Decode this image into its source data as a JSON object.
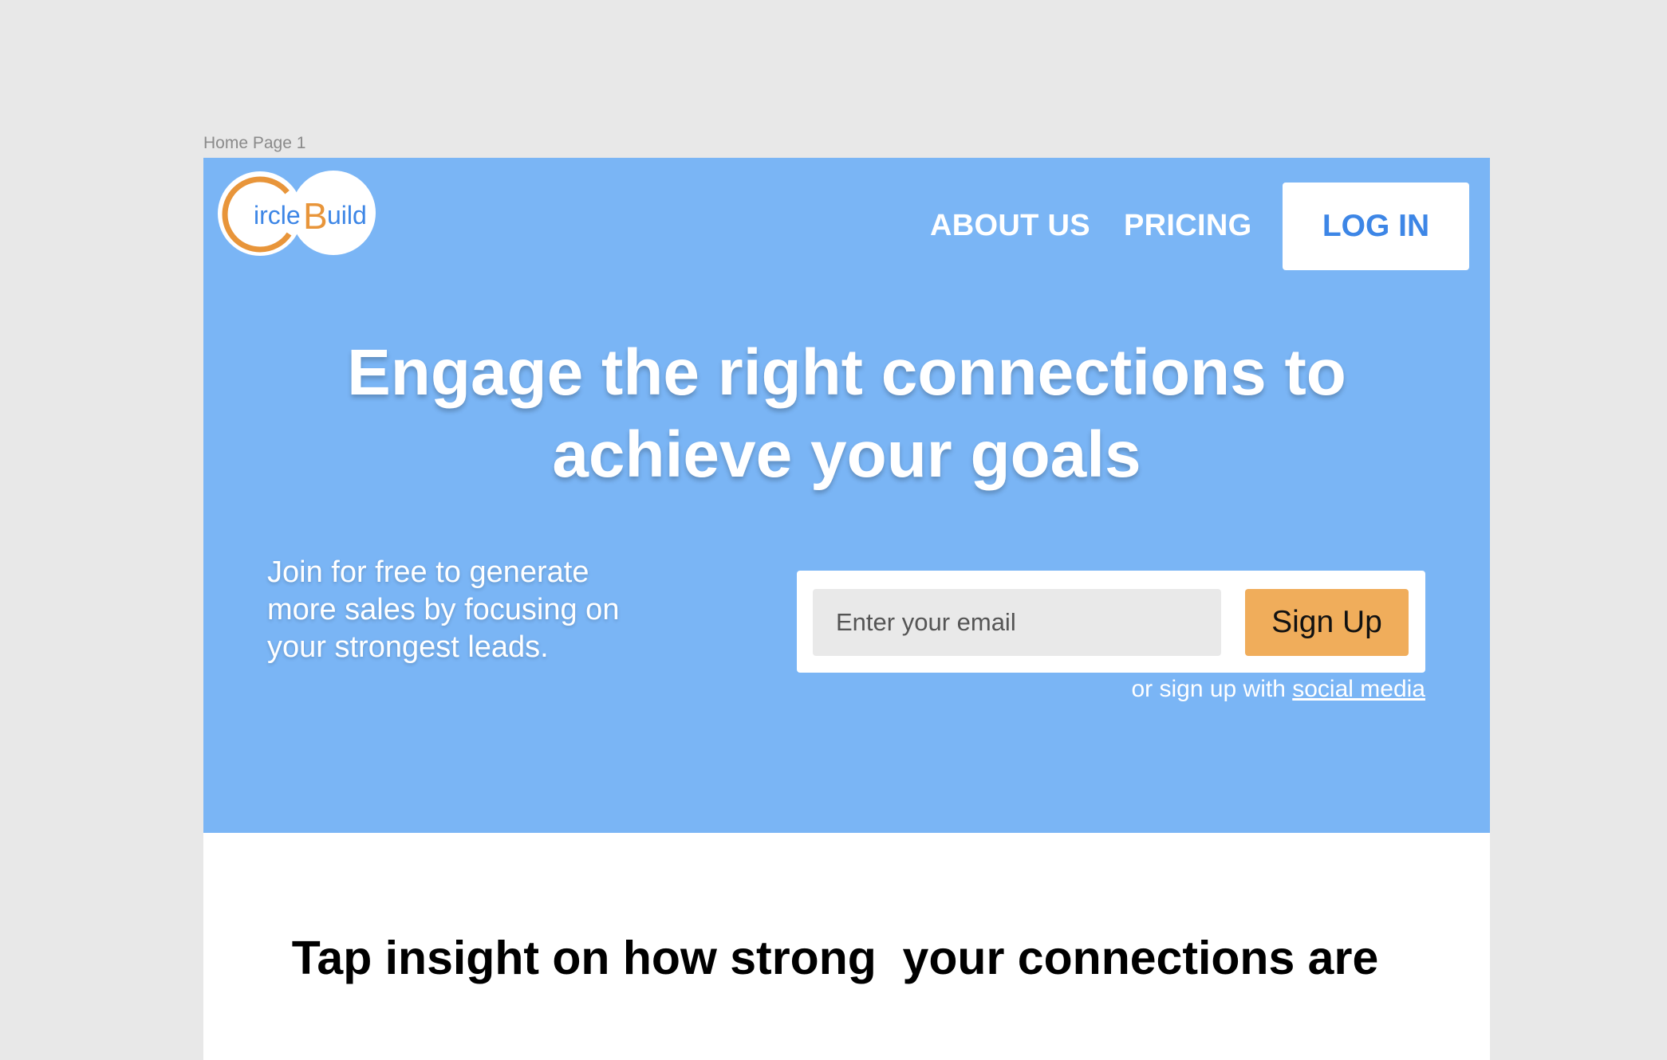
{
  "canvas": {
    "frame_label": "Home Page 1"
  },
  "logo": {
    "letter_c": "C",
    "text_ircle": "ircle",
    "letter_b": "B",
    "text_uild": "uild",
    "colors": {
      "orange": "#e8953a",
      "blue": "#3d86e6"
    }
  },
  "nav": {
    "about": "ABOUT US",
    "pricing": "PRICING",
    "login": "LOG IN"
  },
  "hero": {
    "headline_line1": "Engage the right connections to",
    "headline_line2": "achieve your goals",
    "sub_line1": "Join for free to generate",
    "sub_line2": "more sales by focusing on",
    "sub_line3": "your strongest leads.",
    "background_color": "#7ab5f5"
  },
  "signup": {
    "email_placeholder": "Enter your email",
    "email_value": "",
    "button_label": "Sign Up",
    "button_color": "#f0ad5b",
    "alt_prefix": "or sign up with ",
    "alt_link": "social media"
  },
  "section": {
    "title": "Tap insight on how strong  your connections are"
  }
}
